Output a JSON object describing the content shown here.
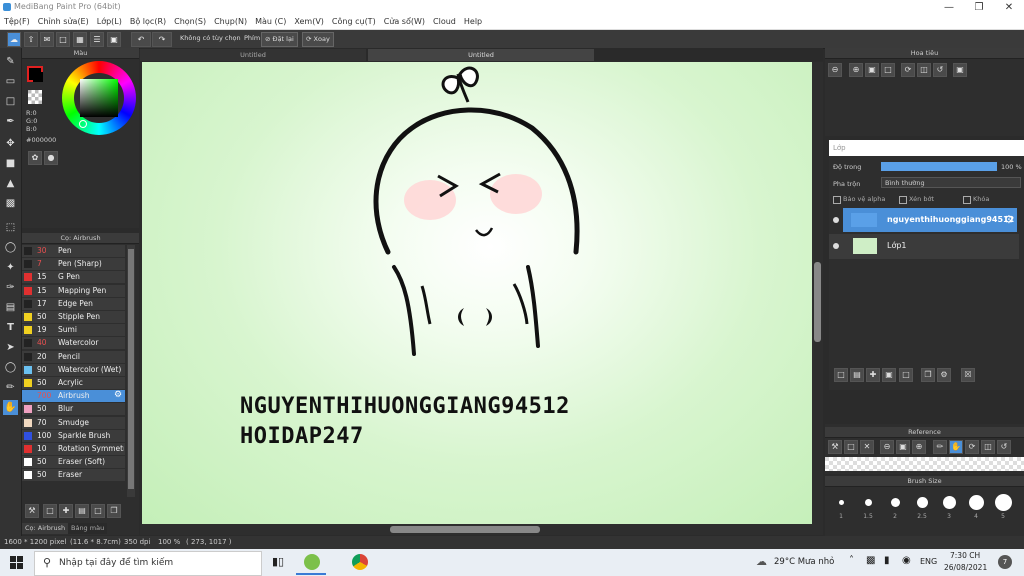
{
  "window": {
    "title": "MediBang Paint Pro (64bit)"
  },
  "menu": [
    "Tệp(F)",
    "Chỉnh sửa(E)",
    "Lớp(L)",
    "Bộ lọc(R)",
    "Chọn(S)",
    "Chụp(N)",
    "Màu (C)",
    "Xem(V)",
    "Công cụ(T)",
    "Cửa sổ(W)",
    "Cloud",
    "Help"
  ],
  "toolbar": {
    "no_selection": "Không có tùy chọn",
    "phim_label": "Phím",
    "reset_label": "Đặt lại",
    "rotate_label": "Xoay"
  },
  "color_panel": {
    "title": "Màu",
    "r": "R:0",
    "g": "G:0",
    "b": "B:0",
    "hex": "#000000",
    "fg_color": "#000000",
    "accent": "#e02020"
  },
  "brush_panel": {
    "title": "Cọ: Airbrush",
    "brushes": [
      {
        "size": "30",
        "name": "Pen",
        "color": "#222222",
        "size_red": true
      },
      {
        "size": "7",
        "name": "Pen (Sharp)",
        "color": "#222222",
        "size_red": true
      },
      {
        "size": "15",
        "name": "G Pen",
        "color": "#e03030",
        "size_red": false
      },
      {
        "size": "15",
        "name": "Mapping Pen",
        "color": "#e03030",
        "size_red": false
      },
      {
        "size": "17",
        "name": "Edge Pen",
        "color": "#222222",
        "size_red": false
      },
      {
        "size": "50",
        "name": "Stipple Pen",
        "color": "#f0d020",
        "size_red": false
      },
      {
        "size": "19",
        "name": "Sumi",
        "color": "#f0d020",
        "size_red": false
      },
      {
        "size": "40",
        "name": "Watercolor",
        "color": "#222222",
        "size_red": true
      },
      {
        "size": "20",
        "name": "Pencil",
        "color": "#222222",
        "size_red": false
      },
      {
        "size": "90",
        "name": "Watercolor (Wet)",
        "color": "#6ac0f0",
        "size_red": false
      },
      {
        "size": "50",
        "name": "Acrylic",
        "color": "#f0d020",
        "size_red": false
      },
      {
        "size": "700",
        "name": "Airbrush",
        "color": "#4a8fd8",
        "size_red": true
      },
      {
        "size": "50",
        "name": "Blur",
        "color": "#f0a0c0",
        "size_red": false
      },
      {
        "size": "70",
        "name": "Smudge",
        "color": "#f0d8c0",
        "size_red": false
      },
      {
        "size": "100",
        "name": "Sparkle Brush",
        "color": "#3050e0",
        "size_red": false
      },
      {
        "size": "10",
        "name": "Rotation Symmetry",
        "color": "#e03030",
        "size_red": false
      },
      {
        "size": "50",
        "name": "Eraser (Soft)",
        "color": "#ffffff",
        "size_red": false
      },
      {
        "size": "50",
        "name": "Eraser",
        "color": "#ffffff",
        "size_red": false
      }
    ],
    "selected_index": 11,
    "tab_brush": "Cọ: Airbrush",
    "tab_palette": "Bảng màu"
  },
  "canvas": {
    "tab_left": "Untitled",
    "tab_right": "Untitled",
    "text_line1": "NGUYENTHIHUONGGIANG94512",
    "text_line2": "HOIDAP247"
  },
  "navigator": {
    "title": "Hoa tiêu"
  },
  "layers": {
    "title": "Lớp",
    "opacity_label": "Độ trong",
    "opacity_value": "100 %",
    "opacity_fraction": 1.0,
    "blend_label": "Pha trộn",
    "blend_value": "Bình thường",
    "protect_alpha": "Bảo vệ alpha",
    "clipping": "Xén bớt",
    "lock": "Khóa",
    "items": [
      {
        "name": "nguyenthihuonggiang94512",
        "selected": true
      },
      {
        "name": "Lớp1",
        "selected": false
      }
    ]
  },
  "reference": {
    "title": "Reference"
  },
  "brush_size": {
    "title": "Brush Size",
    "sizes": [
      "1",
      "1.5",
      "2",
      "2.5",
      "3",
      "4",
      "5"
    ]
  },
  "status": {
    "dimensions": "1600 * 1200 pixel",
    "physical": "(11.6 * 8.7cm)",
    "dpi": "350 dpi",
    "zoom": "100 %",
    "coords": "( 273, 1017 )"
  },
  "taskbar": {
    "search_placeholder": "Nhập tại đây để tìm kiếm",
    "weather": "29°C  Mưa nhỏ",
    "lang": "ENG",
    "time": "7:30 CH",
    "date": "26/08/2021",
    "notif": "7"
  }
}
